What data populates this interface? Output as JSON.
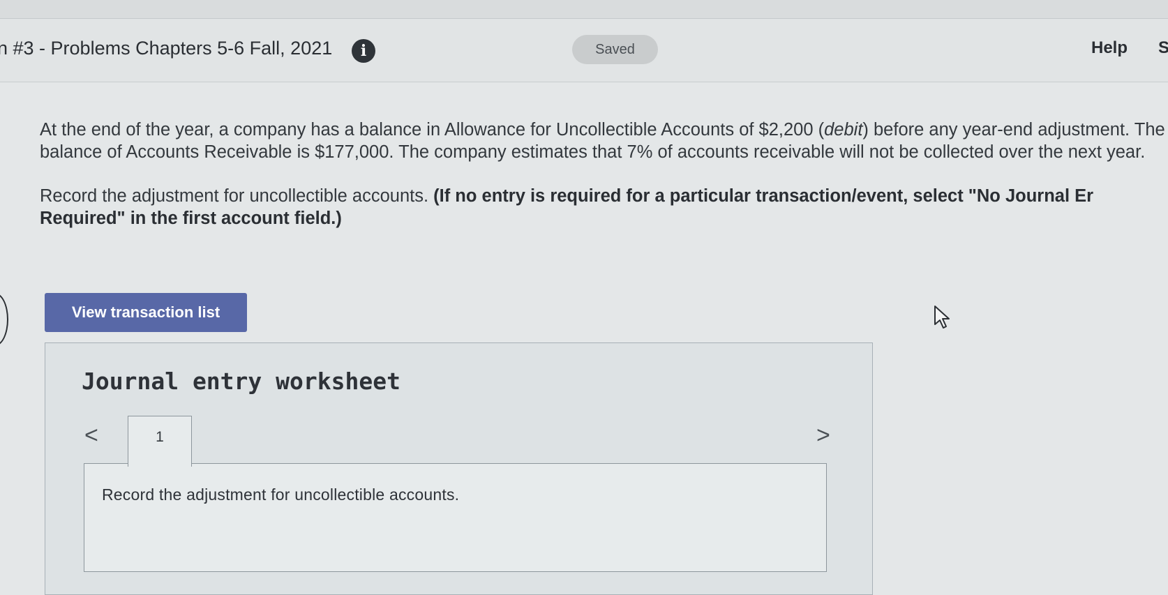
{
  "header": {
    "assignment_title": "n #3 - Problems Chapters 5-6 Fall, 2021",
    "info_icon": "info-icon",
    "saved_label": "Saved",
    "help_label": "Help",
    "cut_label": "S"
  },
  "question": {
    "part1": "At the end of the year, a company has a balance in Allowance for Uncollectible Accounts of $2,200 (",
    "debit": "debit",
    "part2": ") before any year-end adjustment. The balance of Accounts Receivable is $177,000. The company estimates that 7% of accounts receivable will not be collected over the next year.",
    "record_text": "Record the adjustment for uncollectible accounts. ",
    "instruction_line1": "(If no entry is required for a particular transaction/event, select \"No Journal Er",
    "instruction_line2": "Required\" in the first account field.)"
  },
  "buttons": {
    "view_transaction_list": "View transaction list"
  },
  "worksheet": {
    "title": "Journal entry worksheet",
    "prev_icon": "<",
    "next_icon": ">",
    "tabs": [
      {
        "label": "1"
      }
    ],
    "entry_description": "Record the adjustment for uncollectible accounts."
  }
}
